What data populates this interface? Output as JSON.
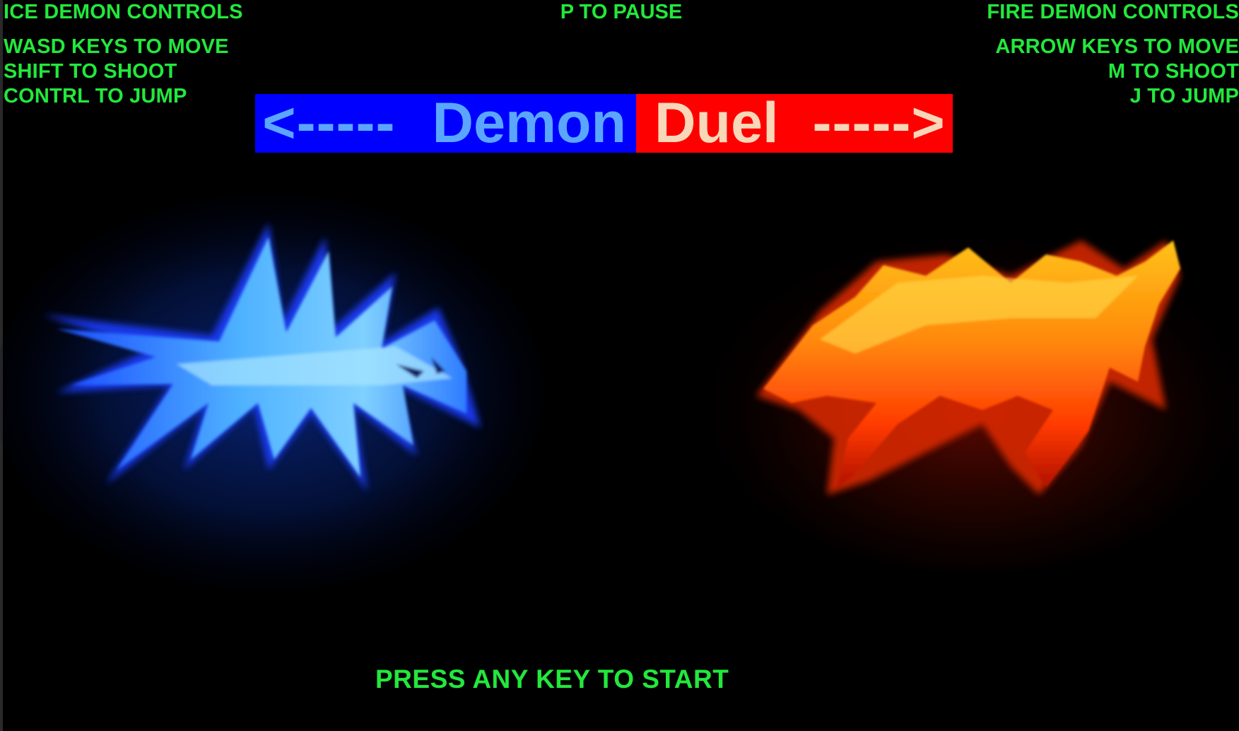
{
  "ice_controls": {
    "heading": "ICE DEMON CONTROLS",
    "lines": [
      "WASD KEYS TO MOVE",
      "SHIFT TO SHOOT",
      "CONTRL TO JUMP"
    ]
  },
  "pause_hint": "P TO PAUSE",
  "fire_controls": {
    "heading": "FIRE DEMON CONTROLS",
    "lines": [
      "ARROW KEYS TO MOVE",
      "M TO SHOOT",
      "J TO JUMP"
    ]
  },
  "title_banner": {
    "left_arrow": "<-----",
    "left_word": "Demon",
    "right_word": "Duel",
    "right_arrow": "----->",
    "left_bg": "#0000ff",
    "left_text_color": "#5aa6ff",
    "right_bg": "#ff0000",
    "right_text_color": "#f8d7b8"
  },
  "characters": {
    "ice": {
      "name": "ice-demon",
      "color": "#3a8cff"
    },
    "fire": {
      "name": "fire-demon",
      "color": "#ff5a10"
    }
  },
  "start_prompt": "PRESS ANY KEY TO START",
  "hud_color": "#22e83c"
}
